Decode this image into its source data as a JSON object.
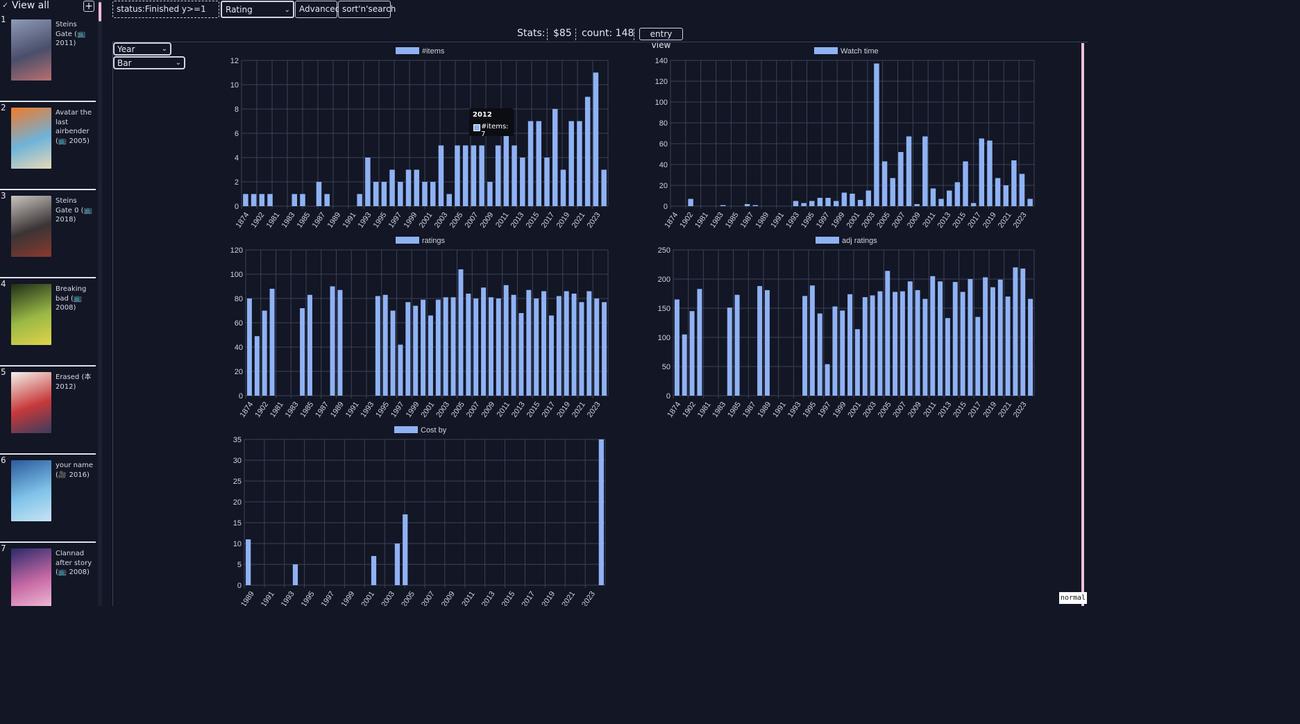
{
  "sidebar": {
    "view_all_label": "View all",
    "add_label": "+",
    "entries": [
      {
        "num": "1",
        "title": "Steins Gate (📺 2011)",
        "colors": [
          "#8e9bb8",
          "#4a4e6a",
          "#b87070"
        ]
      },
      {
        "num": "2",
        "title": "Avatar the last airbender (📺 2005)",
        "colors": [
          "#f07a2a",
          "#6fb3d9",
          "#e8d9b8"
        ]
      },
      {
        "num": "3",
        "title": "Steins Gate 0 (📺 2018)",
        "colors": [
          "#c9c4c0",
          "#3b3435",
          "#8a3a2d"
        ]
      },
      {
        "num": "4",
        "title": "Breaking bad (📺 2008)",
        "colors": [
          "#1d2e18",
          "#9ab845",
          "#e0d44a"
        ]
      },
      {
        "num": "5",
        "title": "Erased (本 2012)",
        "colors": [
          "#f4f1ec",
          "#c73a3a",
          "#3b3b5e"
        ]
      },
      {
        "num": "6",
        "title": "your name (🎥 2016)",
        "colors": [
          "#2a5a9e",
          "#7fc2e8",
          "#c8e4f4"
        ]
      },
      {
        "num": "7",
        "title": "Clannad after story (📺 2008)",
        "colors": [
          "#2a2a6a",
          "#c86aa6",
          "#f0c0d8"
        ]
      }
    ]
  },
  "toolbar": {
    "filter_value": "status:Finished y>=1",
    "rating_value": "Rating",
    "advanced_label": "Advanced",
    "sort_label": "sort'n'search"
  },
  "stats": {
    "label": "Stats:",
    "cost": "$85",
    "count": "count: 148",
    "entry_view_label": "entry view"
  },
  "controls": {
    "group_by": "Year",
    "chart_type": "Bar"
  },
  "mode_label": "normal",
  "accent": "#8fb2f3",
  "tooltip": {
    "title": "2012",
    "line": "#items: 7"
  },
  "chart_data": [
    {
      "type": "bar",
      "title": "#items",
      "series_name": "#items",
      "ylim": [
        0,
        12
      ],
      "ystep": 2,
      "categories": [
        "1874",
        "1902",
        "1981",
        "1983",
        "1985",
        "1986",
        "1987",
        "1989",
        "1990",
        "1991",
        "1993",
        "1994",
        "1995",
        "1996",
        "1997",
        "1998",
        "1999",
        "2000",
        "2001",
        "2002",
        "2003",
        "2004",
        "2005",
        "2006",
        "2007",
        "2008",
        "2009",
        "2010",
        "2011",
        "2012",
        "2013",
        "2014",
        "2015",
        "2016",
        "2017",
        "2018",
        "2019",
        "2020",
        "2021",
        "2022",
        "2023",
        "2024"
      ],
      "values": [
        1,
        1,
        1,
        1,
        0,
        0,
        1,
        1,
        0,
        2,
        1,
        0,
        0,
        0,
        1,
        4,
        2,
        2,
        3,
        2,
        3,
        3,
        2,
        2,
        5,
        1,
        5,
        5,
        5,
        5,
        2,
        5,
        7,
        5,
        4,
        7,
        7,
        4,
        8,
        3,
        7,
        7,
        9,
        11,
        3
      ],
      "xtick_labels": [
        "1874",
        "1902",
        "1981",
        "1983",
        "1985",
        "1987",
        "1989",
        "1991",
        "1993",
        "1995",
        "1997",
        "1999",
        "2001",
        "2003",
        "2005",
        "2007",
        "2009",
        "2011",
        "2013",
        "2015",
        "2017",
        "2019",
        "2021",
        "2023"
      ]
    },
    {
      "type": "bar",
      "title": "Watch time",
      "series_name": "Watch time",
      "ylim": [
        0,
        140
      ],
      "ystep": 20,
      "values": [
        0,
        0,
        7,
        0,
        0,
        0,
        1,
        0,
        0,
        2,
        1,
        0,
        0,
        0,
        0,
        5,
        3,
        5,
        8,
        8,
        5,
        13,
        12,
        6,
        15,
        137,
        43,
        27,
        52,
        67,
        2,
        67,
        17,
        7,
        15,
        23,
        43,
        3,
        65,
        63,
        27,
        20,
        44,
        31,
        7
      ],
      "xtick_labels": [
        "1874",
        "1902",
        "1981",
        "1983",
        "1985",
        "1987",
        "1989",
        "1991",
        "1993",
        "1995",
        "1997",
        "1999",
        "2001",
        "2003",
        "2005",
        "2007",
        "2009",
        "2011",
        "2013",
        "2015",
        "2017",
        "2019",
        "2021",
        "2023"
      ]
    },
    {
      "type": "bar",
      "title": "ratings",
      "series_name": "ratings",
      "ylim": [
        0,
        120
      ],
      "ystep": 20,
      "values": [
        80,
        49,
        70,
        88,
        0,
        0,
        0,
        72,
        83,
        0,
        0,
        90,
        87,
        0,
        0,
        0,
        0,
        82,
        83,
        70,
        42,
        77,
        74,
        79,
        66,
        79,
        81,
        81,
        104,
        84,
        80,
        89,
        81,
        80,
        91,
        83,
        68,
        87,
        80,
        86,
        66,
        82,
        86,
        84,
        77,
        86,
        80,
        77
      ],
      "xtick_labels": [
        "1874",
        "1902",
        "1981",
        "1983",
        "1985",
        "1987",
        "1989",
        "1991",
        "1993",
        "1995",
        "1997",
        "1999",
        "2001",
        "2003",
        "2005",
        "2007",
        "2009",
        "2011",
        "2013",
        "2015",
        "2017",
        "2019",
        "2021",
        "2023"
      ]
    },
    {
      "type": "bar",
      "title": "adj ratings",
      "series_name": "adj ratings",
      "ylim": [
        0,
        250
      ],
      "ystep": 50,
      "values": [
        165,
        105,
        145,
        183,
        0,
        0,
        0,
        151,
        173,
        0,
        0,
        188,
        181,
        0,
        0,
        0,
        0,
        171,
        189,
        141,
        54,
        153,
        146,
        174,
        114,
        169,
        172,
        179,
        214,
        178,
        179,
        196,
        181,
        166,
        205,
        196,
        133,
        195,
        178,
        200,
        135,
        203,
        186,
        199,
        170,
        220,
        218,
        166
      ],
      "xtick_labels": [
        "1874",
        "1902",
        "1981",
        "1983",
        "1985",
        "1987",
        "1989",
        "1991",
        "1993",
        "1995",
        "1997",
        "1999",
        "2001",
        "2003",
        "2005",
        "2007",
        "2009",
        "2011",
        "2013",
        "2015",
        "2017",
        "2019",
        "2021",
        "2023"
      ]
    },
    {
      "type": "bar",
      "title": "Cost by",
      "series_name": "Cost by",
      "ylim": [
        0,
        35
      ],
      "ystep": 5,
      "values": [
        11,
        0,
        0,
        0,
        0,
        0,
        5,
        0,
        0,
        0,
        0,
        0,
        0,
        0,
        0,
        0,
        7,
        0,
        0,
        10,
        17,
        0,
        0,
        0,
        0,
        0,
        0,
        0,
        0,
        0,
        0,
        0,
        0,
        0,
        0,
        0,
        0,
        0,
        0,
        0,
        0,
        0,
        0,
        0,
        0,
        35
      ],
      "xtick_labels": [
        "1989",
        "1991",
        "1993",
        "1995",
        "1997",
        "1999",
        "2001",
        "2003",
        "2005",
        "2007",
        "2009",
        "2011",
        "2013",
        "2015",
        "2017",
        "2019",
        "2021",
        "2023"
      ]
    }
  ]
}
